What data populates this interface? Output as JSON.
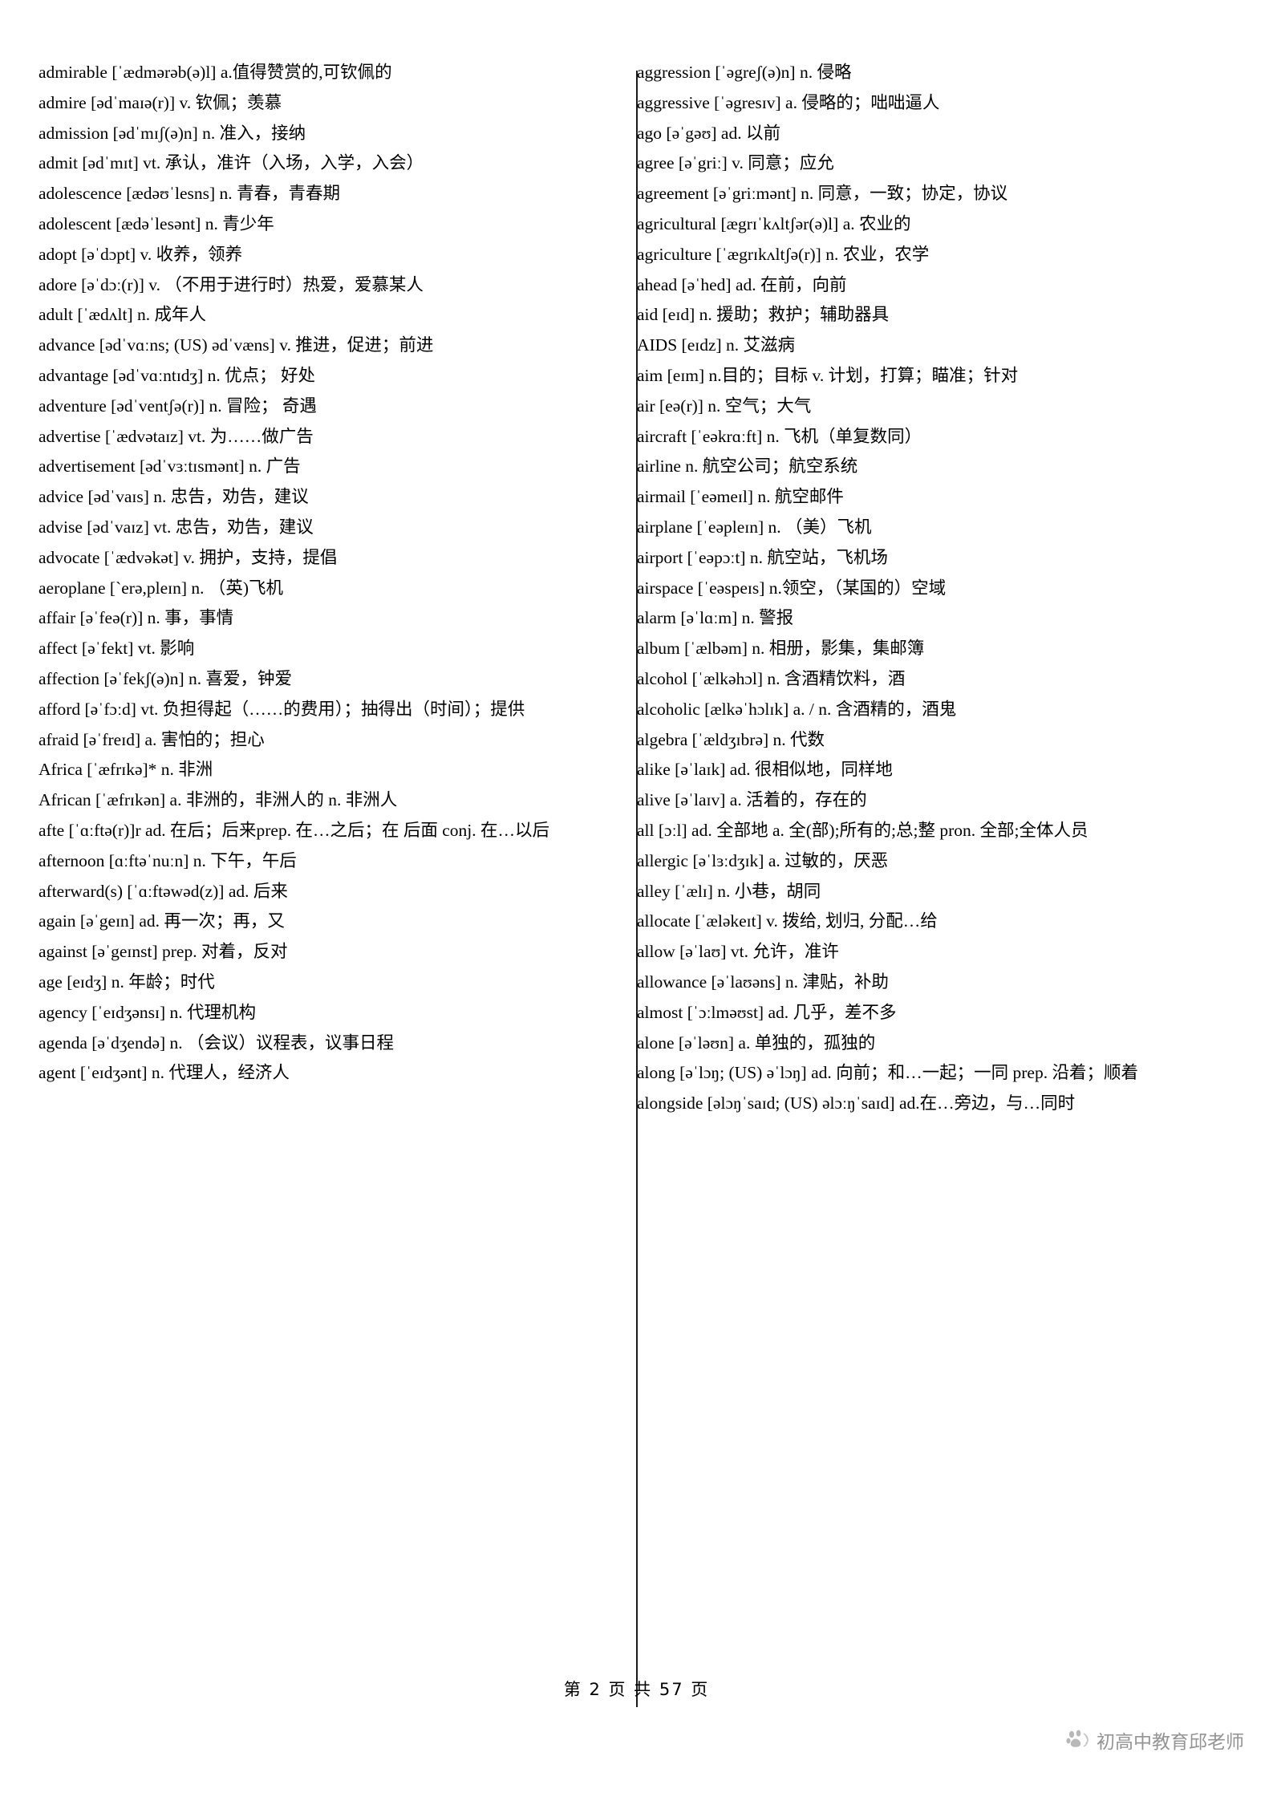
{
  "document": {
    "type": "english-chinese-vocabulary-list",
    "footer": "第 2 页 共 57 页",
    "page_number": "2",
    "total_pages": "57",
    "watermark": "初高中教育邱老师",
    "watermark_icon": "baidu-paw-icon",
    "divider_color": "#1a1a1a",
    "text_color": "#000000",
    "background_color": "#ffffff"
  },
  "columns": {
    "left": [
      "admirable  [ˈædmərəb(ə)l] a.值得赞赏的,可钦佩的",
      "admire  [ədˈmaɪə(r)] v. 钦佩；羡慕",
      "admission  [ədˈmɪʃ(ə)n] n. 准入，接纳",
      "admit  [ədˈmɪt] vt. 承认，准许（入场，入学，入会）",
      "adolescence  [ædəʊˈlesns] n. 青春，青春期",
      "adolescent  [ædəˈlesənt] n. 青少年",
      "adopt  [əˈdɔpt] v. 收养，领养",
      "adore  [əˈdɔː(r)] v. （不用于进行时）热爱，爱慕某人",
      "adult  [ˈædʌlt] n. 成年人",
      "advance  [ədˈvɑːns; (US) ədˈvæns] v. 推进，促进；前进",
      "advantage  [ədˈvɑːntɪdʒ] n. 优点； 好处",
      "adventure  [ədˈventʃə(r)] n. 冒险； 奇遇",
      "advertise  [ˈædvətaɪz] vt. 为……做广告",
      "advertisement  [ədˈvɜːtɪsmənt] n. 广告",
      "advice  [ədˈvaɪs] n. 忠告，劝告，建议",
      "advise  [ədˈvaɪz] vt. 忠告，劝告，建议",
      "advocate  [ˈædvəkət] v. 拥护，支持，提倡",
      "aeroplane  [ˋerə,pleɪn] n. （英)飞机",
      "affair  [əˈfeə(r)] n. 事，事情",
      "affect  [əˈfekt] vt. 影响",
      "affection  [əˈfekʃ(ə)n] n. 喜爱，钟爱",
      "afford  [əˈfɔːd] vt. 负担得起（……的费用）；抽得出（时间）；提供",
      "afraid  [əˈfreɪd] a. 害怕的；担心",
      "Africa [ˈæfrɪkə]* n. 非洲",
      "African  [ˈæfrɪkən] a. 非洲的，非洲人的 n. 非洲人",
      "afte  [ˈɑːftə(r)]r ad. 在后；后来prep. 在…之后；在 后面 conj. 在…以后",
      "afternoon  [ɑːftəˈnuːn] n. 下午，午后",
      "afterward(s) [ˈɑːftəwəd(z)] ad. 后来",
      "again  [əˈgeɪn] ad. 再一次；再，又",
      "against  [əˈgeɪnst] prep. 对着，反对",
      "age  [eɪdʒ] n. 年龄；时代",
      "agency  [ˈeɪdʒənsɪ] n. 代理机构",
      "agenda  [əˈdʒendə] n. （会议）议程表，议事日程",
      "agent  [ˈeɪdʒənt] n. 代理人，经济人"
    ],
    "right": [
      "aggression  [ˈəgreʃ(ə)n] n. 侵略",
      "aggressive  [ˈəgresɪv] a. 侵略的；咄咄逼人",
      "ago [əˈgəʊ] ad. 以前",
      "agree  [əˈgriː] v. 同意；应允",
      "agreement  [əˈgriːmənt] n. 同意，一致；协定，协议",
      "agricultural  [ægrɪˈkʌltʃər(ə)l] a. 农业的",
      "agriculture  [ˈægrɪkʌltʃə(r)] n. 农业，农学",
      "ahead  [əˈhed] ad. 在前，向前",
      "aid  [eɪd] n. 援助；救护；辅助器具",
      "AIDS  [eɪdz] n. 艾滋病",
      "aim  [eɪm] n.目的；目标 v. 计划，打算；瞄准；针对",
      "air  [eə(r)] n. 空气；大气",
      "aircraft  [ˈeəkrɑːft] n. 飞机（单复数同）",
      "airline n. 航空公司；航空系统",
      "airmail  [ˈeəmeɪl] n. 航空邮件",
      "airplane  [ˈeəpleɪn] n. （美）飞机",
      "airport  [ˈeəpɔːt] n. 航空站，飞机场",
      "airspace  [ˈeəspeɪs] n.领空，（某国的）空域",
      "alarm  [əˈlɑːm] n. 警报",
      "album  [ˈælbəm] n. 相册，影集，集邮簿",
      "alcohol  [ˈælkəhɔl] n. 含酒精饮料，酒",
      "alcoholic  [ælkəˈhɔlɪk] a. / n. 含酒精的，酒鬼",
      "algebra  [ˈældʒɪbrə] n. 代数",
      "alike  [əˈlaɪk] ad. 很相似地，同样地",
      "alive  [əˈlaɪv] a. 活着的，存在的",
      "all  [ɔːl] ad. 全部地 a. 全(部);所有的;总;整 pron. 全部;全体人员",
      "allergic  [əˈlɜːdʒɪk] a. 过敏的，厌恶",
      "alley  [ˈælɪ] n. 小巷，胡同",
      "allocate  [ˈæləkeɪt] v. 拨给, 划归, 分配…给",
      "allow  [əˈlaʊ] vt. 允许，准许",
      "allowance  [əˈlaʊəns] n. 津贴，补助",
      "almost  [ˈɔːlməʊst] ad. 几乎，差不多",
      "alone  [əˈləʊn] a. 单独的，孤独的",
      "along  [əˈlɔŋ; (US) əˈlɔŋ] ad. 向前；和…一起；一同 prep. 沿着；顺着",
      "alongside  [əlɔŋˈsaɪd; (US) əlɔːŋˈsaɪd] ad.在…旁边，与…同时"
    ]
  }
}
